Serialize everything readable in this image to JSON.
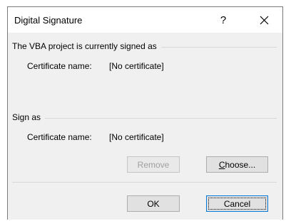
{
  "window": {
    "title": "Digital Signature",
    "help_label": "?",
    "close_icon": "close-icon"
  },
  "current": {
    "heading": "The VBA project is currently signed as",
    "cert_label": "Certificate name:",
    "cert_value": "[No certificate]"
  },
  "sign_as": {
    "heading": "Sign as",
    "cert_label": "Certificate name:",
    "cert_value": "[No certificate]"
  },
  "buttons": {
    "remove": "Remove",
    "choose_mnemonic": "C",
    "choose_rest": "hoose...",
    "ok": "OK",
    "cancel": "Cancel"
  }
}
